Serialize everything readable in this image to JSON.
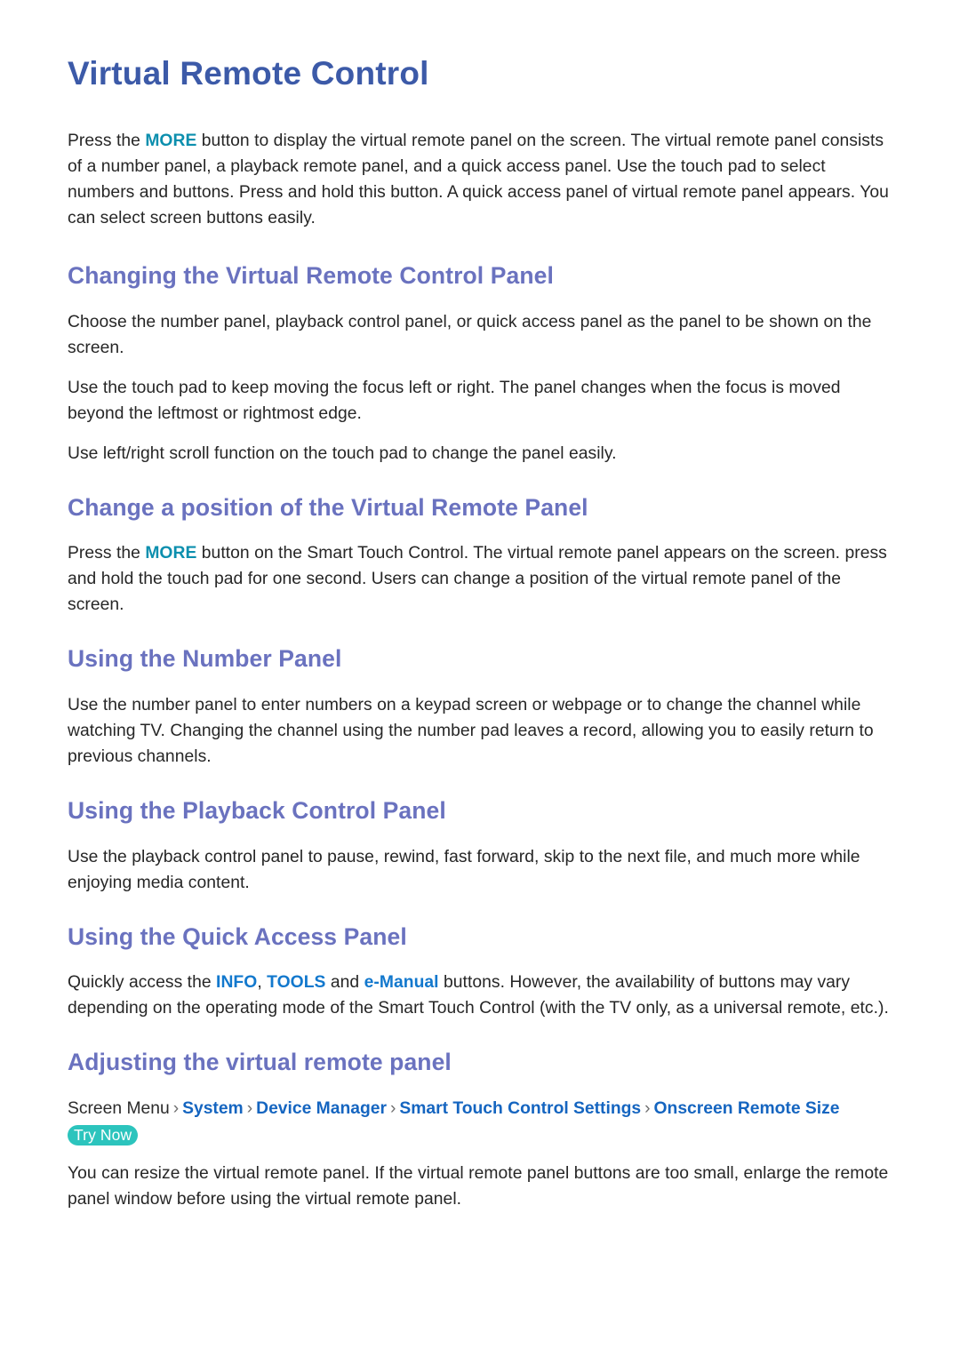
{
  "document": {
    "title": "Virtual Remote Control",
    "intro_paragraph": {
      "part1": "Press the ",
      "keyword1": "MORE",
      "part2": " button to display the virtual remote panel on the screen. The virtual remote panel consists of a number panel, a playback remote panel, and a quick access panel. Use the touch pad to select numbers and buttons. Press and hold this button. A quick access panel of virtual remote panel appears. You can select screen buttons easily."
    },
    "sections": [
      {
        "heading": "Changing the Virtual Remote Control Panel",
        "paragraphs": [
          "Choose the number panel, playback control panel, or quick access panel as the panel to be shown on the screen.",
          "Use the touch pad to keep moving the focus left or right. The panel changes when the focus is moved beyond the leftmost or rightmost edge.",
          "Use left/right scroll function on the touch pad to change the panel easily."
        ]
      },
      {
        "heading": "Change a position of the Virtual Remote Panel",
        "paragraph": {
          "part1": "Press the ",
          "keyword1": "MORE",
          "part2": " button on the Smart Touch Control. The virtual remote panel appears on the screen. press and hold the touch pad for one second. Users can change a position of the virtual remote panel of the screen."
        }
      },
      {
        "heading": "Using the Number Panel",
        "paragraphs": [
          "Use the number panel to enter numbers on a keypad screen or webpage or to change the channel while watching TV. Changing the channel using the number pad leaves a record, allowing you to easily return to previous channels."
        ]
      },
      {
        "heading": "Using the Playback Control Panel",
        "paragraphs": [
          "Use the playback control panel to pause, rewind, fast forward, skip to the next file, and much more while enjoying media content."
        ]
      },
      {
        "heading": "Using the Quick Access Panel",
        "paragraph": {
          "part1": "Quickly access the ",
          "keyword1": "INFO",
          "part2": ", ",
          "keyword2": "TOOLS",
          "part3": " and ",
          "keyword3": "e-Manual",
          "part4": " buttons. However, the availability of buttons may vary depending on the operating mode of the Smart Touch Control (with the TV only, as a universal remote, etc.)."
        }
      },
      {
        "heading": "Adjusting the virtual remote panel",
        "breadcrumb": {
          "root": "Screen Menu",
          "separator": "›",
          "items": [
            "System",
            "Device Manager",
            "Smart Touch Control Settings",
            "Onscreen Remote Size"
          ]
        },
        "badge": "Try Now",
        "paragraphs": [
          "You can resize the virtual remote panel. If the virtual remote panel buttons are too small, enlarge the remote panel window before using the virtual remote panel."
        ]
      }
    ],
    "colors": {
      "page_title": "#3c5aa8",
      "section_heading": "#6a72bf",
      "keyword_teal": "#0c8fae",
      "keyword_blue": "#1278cd",
      "breadcrumb_link": "#1565c0",
      "badge_background": "#2cc4bd",
      "body_text": "#262626"
    }
  }
}
